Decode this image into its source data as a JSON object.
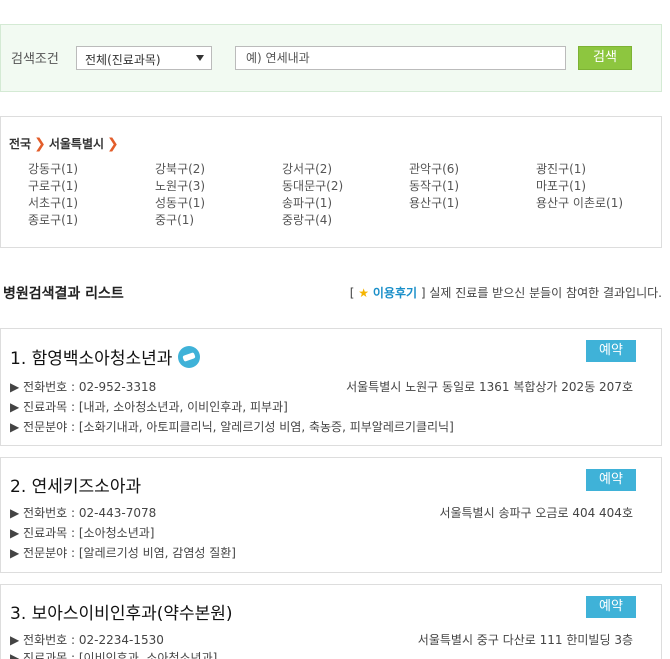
{
  "search": {
    "label": "검색조건",
    "dept_selected": "전체(진료과목)",
    "placeholder": "예) 연세내과",
    "button_label": "검색",
    "accent": "#8dc63f"
  },
  "region": {
    "level1": "전국",
    "level2": "서울특별시",
    "districts": [
      "강동구(1)",
      "강북구(2)",
      "강서구(2)",
      "관악구(6)",
      "광진구(1)",
      "구로구(1)",
      "노원구(3)",
      "동대문구(2)",
      "동작구(1)",
      "마포구(1)",
      "서초구(1)",
      "성동구(1)",
      "송파구(1)",
      "용산구(1)",
      "용산구 이촌로(1)",
      "종로구(1)",
      "중구(1)",
      "중랑구(4)"
    ]
  },
  "results": {
    "title": "병원검색결과 리스트",
    "note_open": "[ ",
    "review_label": "이용후기",
    "note_close": " ] 실제 진료를 받으신 분들이 참여한 결과입니다.",
    "reserve_label": "예약",
    "reserve_color": "#3fb2d8",
    "items": [
      {
        "title": "1. 함영백소아청소년과",
        "phone": "▶ 전화번호 : 02-952-3318",
        "address": "서울특별시 노원구 동일로 1361 복합상가 202동 207호",
        "dept": "▶ 진료과목 : [내과, 소아청소년과, 이비인후과, 피부과]",
        "specialty": "▶ 전문분야 : [소화기내과, 아토피클리닉, 알레르기성 비염, 축농증, 피부알레르기클리닉]"
      },
      {
        "title": "2. 연세키즈소아과",
        "phone": "▶ 전화번호 : 02-443-7078",
        "address": "서울특별시 송파구 오금로 404 404호",
        "dept": "▶ 진료과목 : [소아청소년과]",
        "specialty": "▶ 전문분야 : [알레르기성 비염, 감염성 질환]"
      },
      {
        "title": "3. 보아스이비인후과(약수본원)",
        "phone": "▶ 전화번호 : 02-2234-1530",
        "address": "서울특별시 중구 다산로 111 한미빌딩 3층",
        "dept": "▶ 진료과목 : [이비인후과, 소아청소년과]"
      }
    ]
  }
}
